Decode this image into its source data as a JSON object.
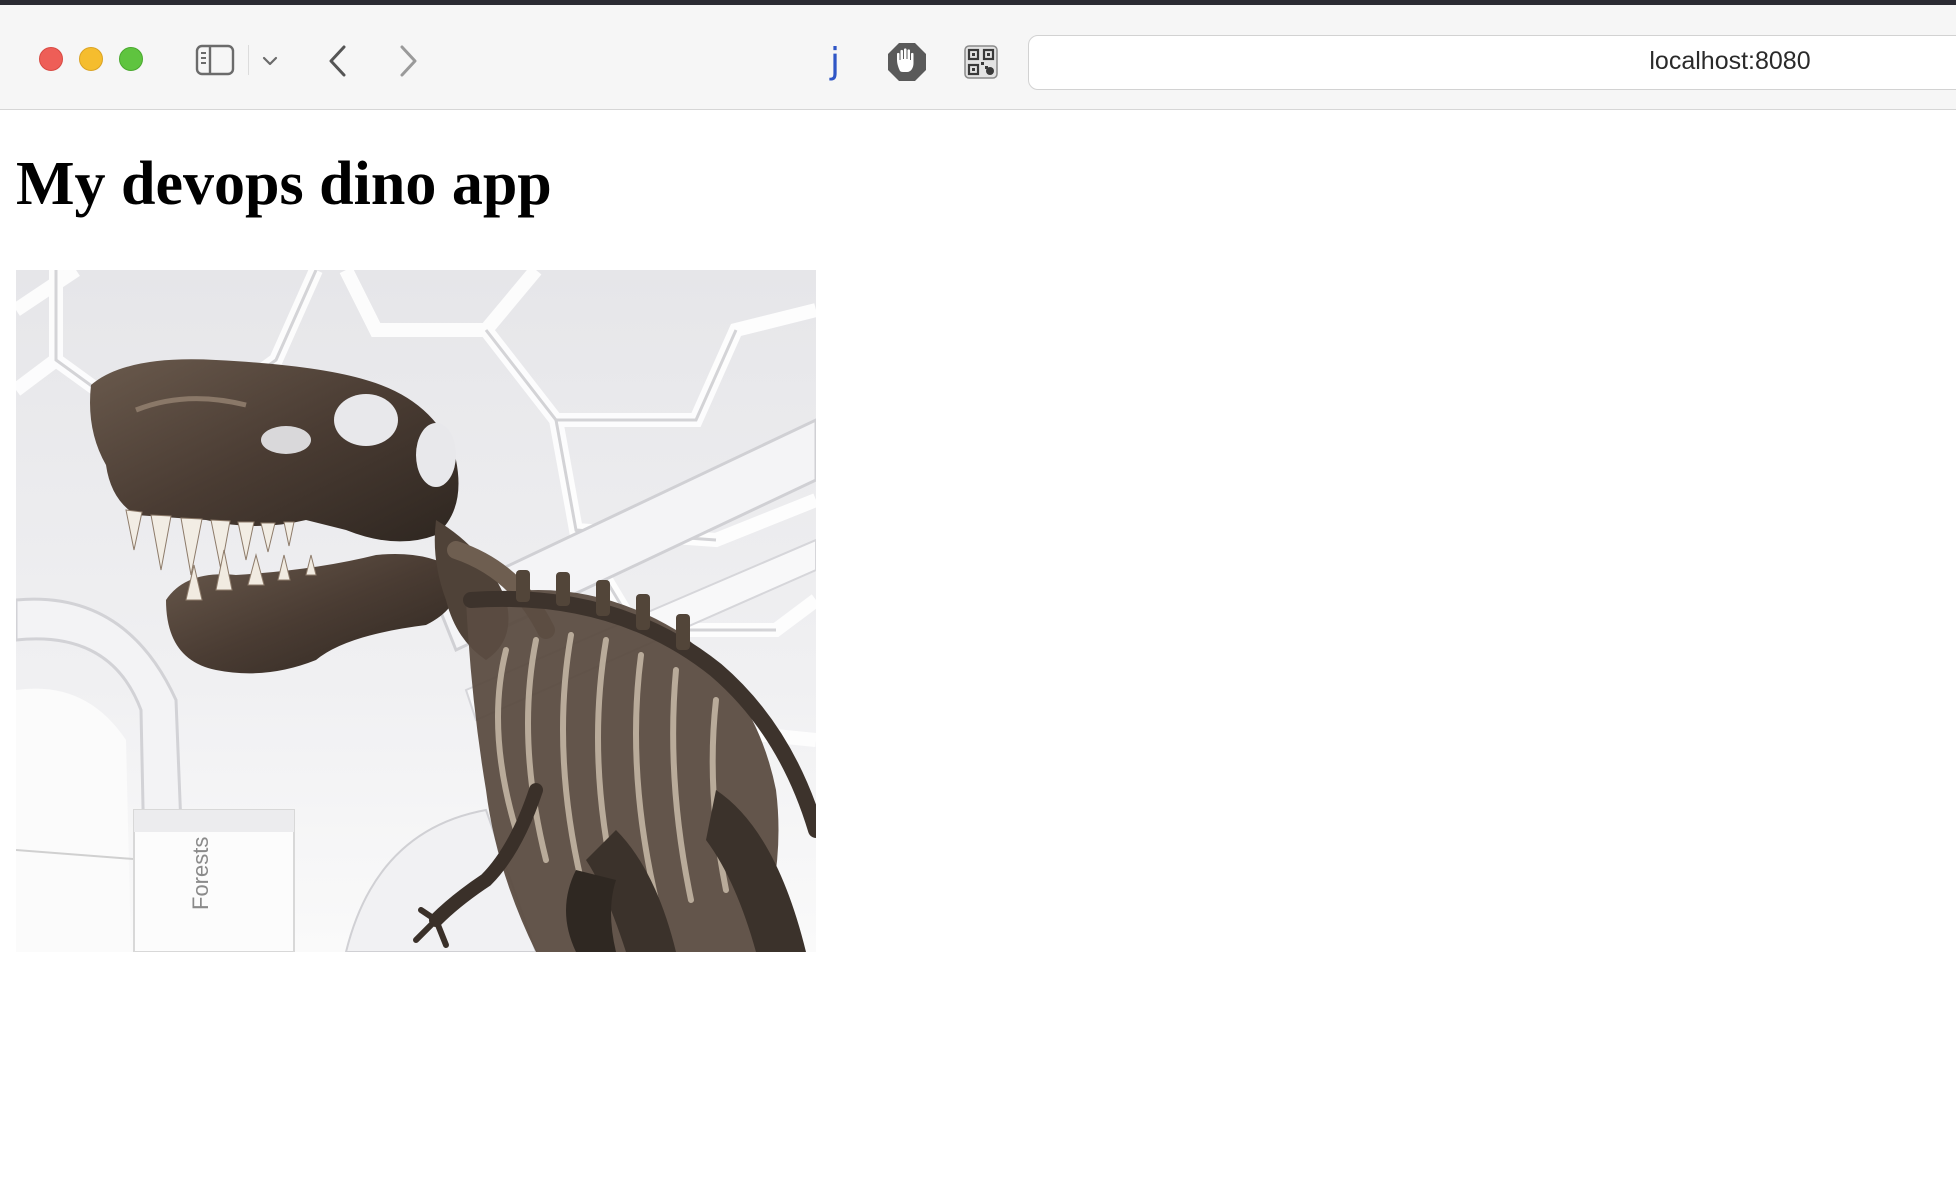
{
  "browser": {
    "address": "localhost:8080",
    "extensions": {
      "j_label": "j"
    },
    "icons": [
      "sidebar-icon",
      "chevron-down-icon",
      "back-arrow-icon",
      "forward-arrow-icon",
      "stop-hand-icon",
      "qr-code-icon"
    ]
  },
  "page": {
    "title": "My devops dino app",
    "image": {
      "subject": "t-rex-skeleton",
      "sign_text": "Forests"
    }
  },
  "colors": {
    "close": "#ee5e57",
    "minimize": "#f5bd2e",
    "maximize": "#5fc43f",
    "extension_blue": "#2f56c6"
  }
}
